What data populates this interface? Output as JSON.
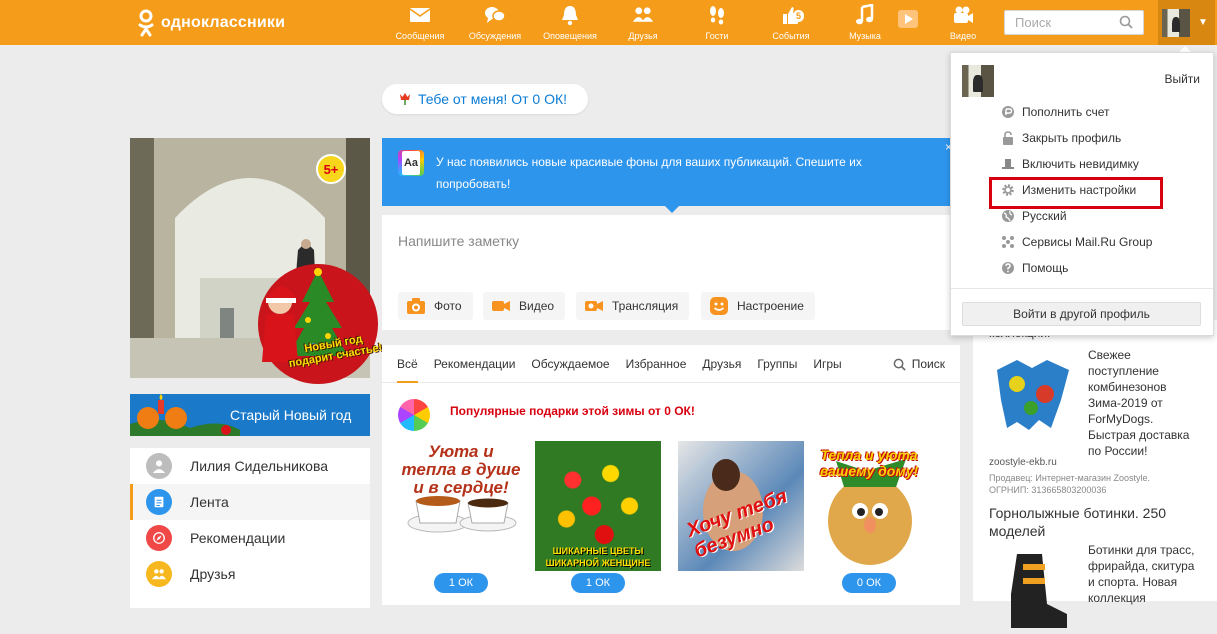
{
  "header": {
    "logo_text": "одноклассники",
    "nav": [
      {
        "label": "Сообщения",
        "icon": "envelope-icon"
      },
      {
        "label": "Обсуждения",
        "icon": "chat-bubbles-icon"
      },
      {
        "label": "Оповещения",
        "icon": "bell-icon"
      },
      {
        "label": "Друзья",
        "icon": "friends-icon"
      },
      {
        "label": "Гости",
        "icon": "footprints-icon"
      },
      {
        "label": "События",
        "icon": "thumbs-up-icon",
        "badge": "5"
      },
      {
        "label": "Музыка",
        "icon": "music-note-icon"
      },
      {
        "label": "",
        "icon": "play-video-icon"
      },
      {
        "label": "Видео",
        "icon": "video-camera-icon"
      }
    ],
    "search_placeholder": "Поиск"
  },
  "gift_pill": "Тебе от меня! От 0 ОК!",
  "profile": {
    "age_badge": "5+",
    "new_year_text": "Новый год подарит счастье!",
    "old_new_year": "Старый Новый год"
  },
  "left_nav": [
    {
      "label": "Лилия Сидельникова",
      "icon": "user-avatar-icon"
    },
    {
      "label": "Лента",
      "icon": "feed-icon",
      "active": true
    },
    {
      "label": "Рекомендации",
      "icon": "compass-icon"
    },
    {
      "label": "Друзья",
      "icon": "friends-icon"
    }
  ],
  "notice": {
    "icon_text": "Aa",
    "text": "У нас появились новые красивые фоны для ваших публикаций. Спешите их попробовать!"
  },
  "composer": {
    "placeholder": "Напишите заметку",
    "buttons": [
      "Фото",
      "Видео",
      "Трансляция",
      "Настроение"
    ]
  },
  "feed": {
    "tabs": [
      "Всё",
      "Рекомендации",
      "Обсуждаемое",
      "Избранное",
      "Друзья",
      "Группы",
      "Игры"
    ],
    "search": "Поиск",
    "gifts_title": "Популярные подарки этой зимы от 0 ОК!",
    "gifts": [
      {
        "caption": "Уюта и тепла в душе и в сердце!",
        "price": "1 ОК"
      },
      {
        "caption": "ШИКАРНЫЕ ЦВЕТЫ ШИКАРНОЙ ЖЕНЩИНЕ",
        "price": "1 ОК"
      },
      {
        "caption": "Хочу тебя безумно",
        "price": ""
      },
      {
        "caption": "Тепла и уюта вашему дому!",
        "price": "0 ОК"
      }
    ]
  },
  "right_col": {
    "partial_top": "коллекции.",
    "ad1_text": "Свежее поступление комбинезонов Зима-2019 от ForMyDogs. Быстрая доставка по России!",
    "ad1_link": "zoostyle-ekb.ru",
    "ad1_seller": "Продавец: Интернет-магазин Zoostyle.",
    "ad1_ogrn": "ОГРНИП: 313665803200036",
    "ad2_title": "Горнолыжные ботинки. 250 моделей",
    "ad2_text": "Ботинки для трасс, фрирайда, скитура и спорта. Новая коллекция"
  },
  "dropdown": {
    "logout": "Выйти",
    "items": [
      {
        "label": "Пополнить счет",
        "icon": "coin-icon"
      },
      {
        "label": "Закрыть профиль",
        "icon": "lock-icon"
      },
      {
        "label": "Включить невидимку",
        "icon": "invisible-hat-icon"
      },
      {
        "label": "Изменить настройки",
        "icon": "gear-icon"
      },
      {
        "label": "Русский",
        "icon": "globe-icon"
      },
      {
        "label": "Сервисы Mail.Ru Group",
        "icon": "services-grid-icon"
      },
      {
        "label": "Помощь",
        "icon": "help-icon"
      }
    ],
    "switch_profile": "Войти в другой профиль"
  },
  "colors": {
    "brand": "#f59c1a",
    "link": "#0c7cd5",
    "notice": "#2e95ed",
    "highlight": "#d8000f"
  }
}
